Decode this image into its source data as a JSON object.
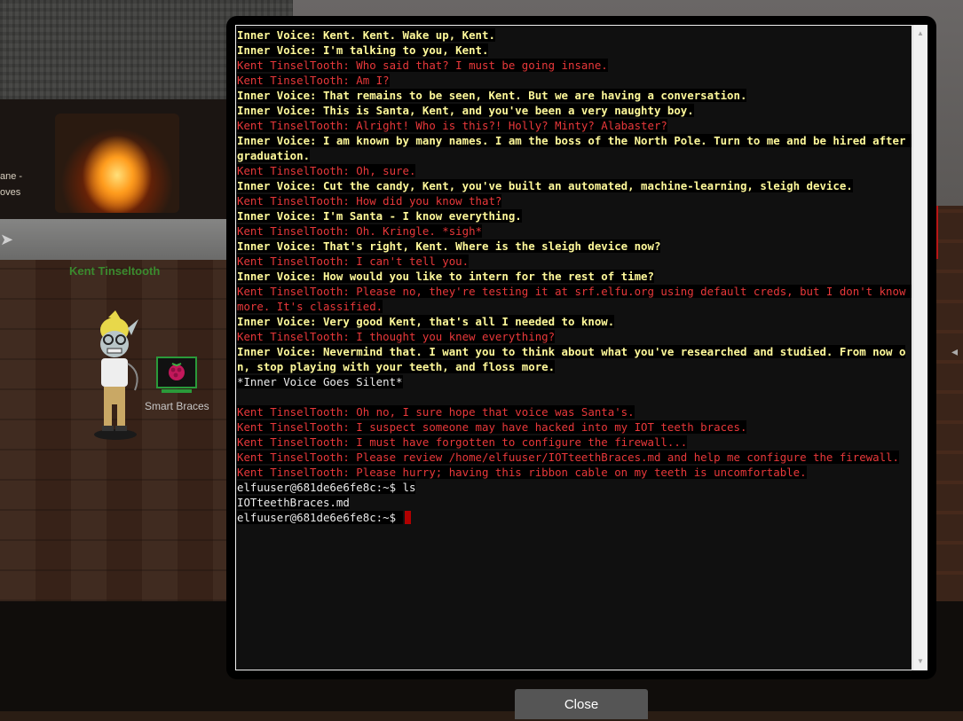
{
  "game": {
    "sign_text_1": "ane -",
    "sign_text_2": "oves",
    "npc_name": "Kent Tinseltooth",
    "terminal_name": "Smart Braces"
  },
  "terminal": {
    "lines": [
      {
        "type": "voice",
        "text": "Inner Voice: Kent. Kent. Wake up, Kent."
      },
      {
        "type": "voice",
        "text": "Inner Voice: I'm talking to you, Kent."
      },
      {
        "type": "kent",
        "text": "Kent TinselTooth: Who said that? I must be going insane."
      },
      {
        "type": "kent",
        "text": "Kent TinselTooth: Am I?"
      },
      {
        "type": "voice",
        "text": "Inner Voice: That remains to be seen, Kent. But we are having a conversation."
      },
      {
        "type": "voice",
        "text": "Inner Voice: This is Santa, Kent, and you've been a very naughty boy."
      },
      {
        "type": "kent",
        "text": "Kent TinselTooth: Alright! Who is this?! Holly? Minty? Alabaster?"
      },
      {
        "type": "voice",
        "text": "Inner Voice: I am known by many names. I am the boss of the North Pole. Turn to me and be hired after graduation."
      },
      {
        "type": "kent",
        "text": "Kent TinselTooth: Oh, sure."
      },
      {
        "type": "voice",
        "text": "Inner Voice: Cut the candy, Kent, you've built an automated, machine-learning, sleigh device."
      },
      {
        "type": "kent",
        "text": "Kent TinselTooth: How did you know that?"
      },
      {
        "type": "voice",
        "text": "Inner Voice: I'm Santa - I know everything."
      },
      {
        "type": "kent",
        "text": "Kent TinselTooth: Oh. Kringle. *sigh*"
      },
      {
        "type": "voice",
        "text": "Inner Voice: That's right, Kent. Where is the sleigh device now?"
      },
      {
        "type": "kent",
        "text": "Kent TinselTooth: I can't tell you."
      },
      {
        "type": "voice",
        "text": "Inner Voice: How would you like to intern for the rest of time?"
      },
      {
        "type": "kent",
        "text": "Kent TinselTooth: Please no, they're testing it at srf.elfu.org using default creds, but I don't know more. It's classified."
      },
      {
        "type": "voice",
        "text": "Inner Voice: Very good Kent, that's all I needed to know."
      },
      {
        "type": "kent",
        "text": "Kent TinselTooth: I thought you knew everything?"
      },
      {
        "type": "voice",
        "text": "Inner Voice: Nevermind that. I want you to think about what you've researched and studied. From now on, stop playing with your teeth, and floss more."
      },
      {
        "type": "white",
        "text": "*Inner Voice Goes Silent*"
      },
      {
        "type": "blank",
        "text": ""
      },
      {
        "type": "kent",
        "text": "Kent TinselTooth: Oh no, I sure hope that voice was Santa's."
      },
      {
        "type": "kent",
        "text": "Kent TinselTooth: I suspect someone may have hacked into my IOT teeth braces."
      },
      {
        "type": "kent",
        "text": "Kent TinselTooth: I must have forgotten to configure the firewall..."
      },
      {
        "type": "kent",
        "text": "Kent TinselTooth: Please review /home/elfuuser/IOTteethBraces.md and help me configure the firewall."
      },
      {
        "type": "kent",
        "text": "Kent TinselTooth: Please hurry; having this ribbon cable on my teeth is uncomfortable."
      },
      {
        "type": "shell",
        "text": "elfuuser@681de6e6fe8c:~$ ls"
      },
      {
        "type": "shell",
        "text": "IOTteethBraces.md"
      },
      {
        "type": "prompt",
        "text": "elfuuser@681de6e6fe8c:~$ "
      }
    ]
  },
  "close_label": "Close",
  "colors": {
    "voice": "#fff99a",
    "kent": "#e8383a",
    "cursor": "#b00000"
  }
}
